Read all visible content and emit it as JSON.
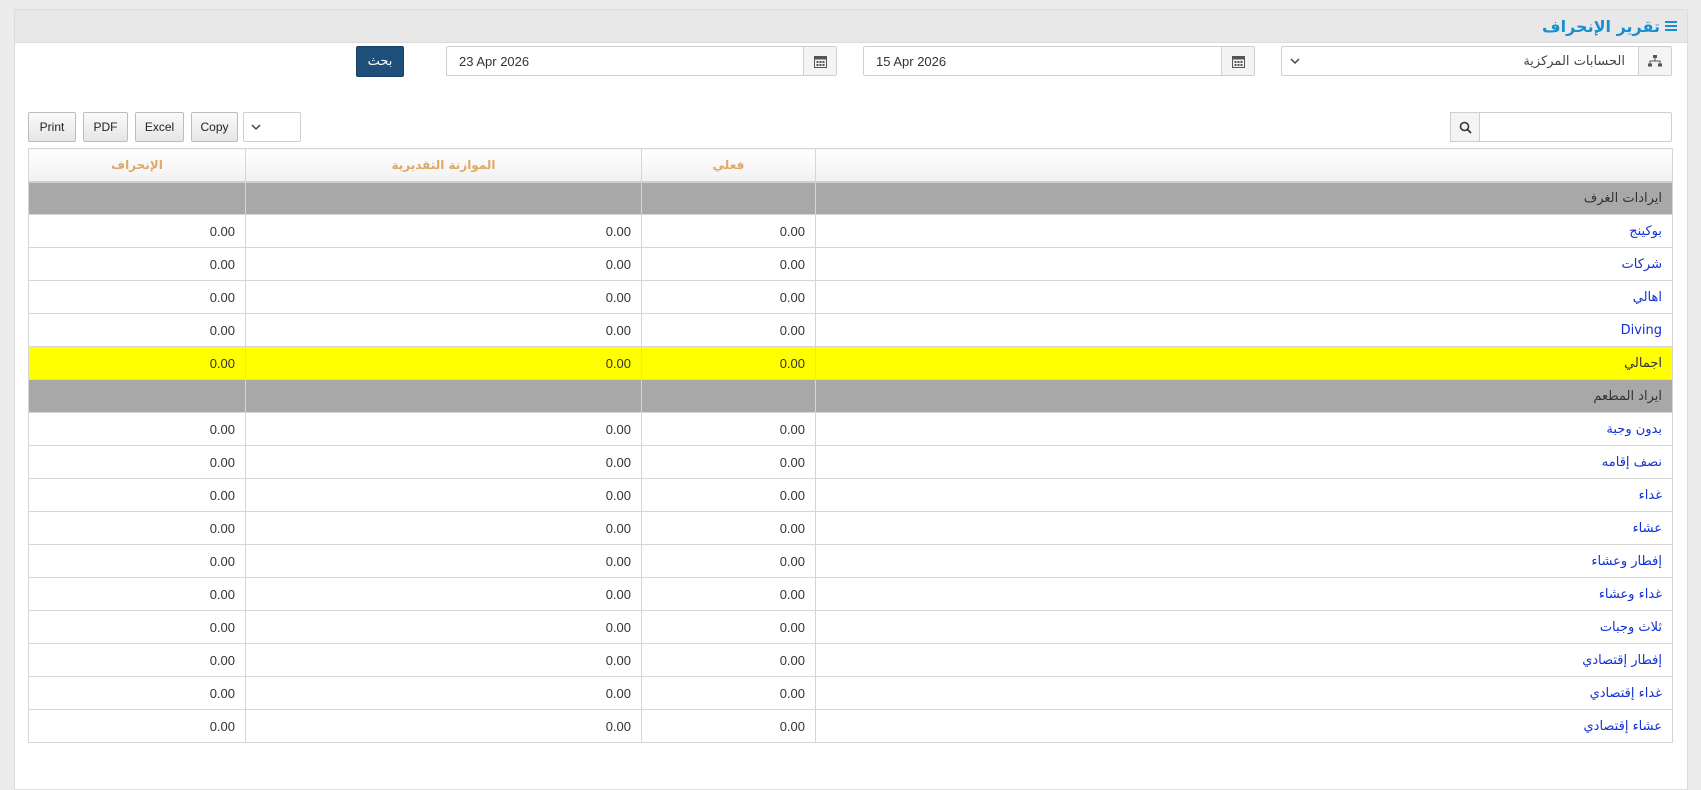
{
  "header": {
    "title": "تقرير الإنحراف",
    "icon": "bars-icon"
  },
  "filters": {
    "account_select": {
      "value": "الحسابات المركزية",
      "icon": "sitemap-icon"
    },
    "date_from": {
      "value": "15 Apr 2026",
      "icon": "calendar-icon"
    },
    "date_to": {
      "value": "23 Apr 2026",
      "icon": "calendar-icon"
    },
    "search_label": "بحث"
  },
  "toolbar": {
    "print": "Print",
    "pdf": "PDF",
    "excel": "Excel",
    "copy": "Copy",
    "page_length": ""
  },
  "table": {
    "columns": [
      "",
      "فعلي",
      "الموازنة التقديرية",
      "الإنحراف"
    ],
    "rows": [
      {
        "type": "group",
        "name": "ايرادات الغرف",
        "actual": "",
        "budget": "",
        "variance": ""
      },
      {
        "type": "item",
        "name": "بوكينج",
        "actual": "0.00",
        "budget": "0.00",
        "variance": "0.00"
      },
      {
        "type": "item",
        "name": "شركات",
        "actual": "0.00",
        "budget": "0.00",
        "variance": "0.00"
      },
      {
        "type": "item",
        "name": "اهالي",
        "actual": "0.00",
        "budget": "0.00",
        "variance": "0.00"
      },
      {
        "type": "item",
        "name": "Diving",
        "actual": "0.00",
        "budget": "0.00",
        "variance": "0.00"
      },
      {
        "type": "total",
        "name": "اجمالي",
        "actual": "0.00",
        "budget": "0.00",
        "variance": "0.00"
      },
      {
        "type": "group",
        "name": "ايراد المطعم",
        "actual": "",
        "budget": "",
        "variance": ""
      },
      {
        "type": "item",
        "name": "بدون وجبة",
        "actual": "0.00",
        "budget": "0.00",
        "variance": "0.00"
      },
      {
        "type": "item",
        "name": "نصف إقامه",
        "actual": "0.00",
        "budget": "0.00",
        "variance": "0.00"
      },
      {
        "type": "item",
        "name": "غداء",
        "actual": "0.00",
        "budget": "0.00",
        "variance": "0.00"
      },
      {
        "type": "item",
        "name": "عشاء",
        "actual": "0.00",
        "budget": "0.00",
        "variance": "0.00"
      },
      {
        "type": "item",
        "name": "إفطار وعشاء",
        "actual": "0.00",
        "budget": "0.00",
        "variance": "0.00"
      },
      {
        "type": "item",
        "name": "غداء وعشاء",
        "actual": "0.00",
        "budget": "0.00",
        "variance": "0.00"
      },
      {
        "type": "item",
        "name": "ثلاث وجبات",
        "actual": "0.00",
        "budget": "0.00",
        "variance": "0.00"
      },
      {
        "type": "item",
        "name": "إفطار إقتصادي",
        "actual": "0.00",
        "budget": "0.00",
        "variance": "0.00"
      },
      {
        "type": "item",
        "name": "غداء إقتصادي",
        "actual": "0.00",
        "budget": "0.00",
        "variance": "0.00"
      },
      {
        "type": "item",
        "name": "عشاء إقتصادي",
        "actual": "0.00",
        "budget": "0.00",
        "variance": "0.00"
      }
    ]
  },
  "colors": {
    "accent": "#1a8fd0",
    "search_button": "#1e4f7a",
    "group_row": "#a8a8a8",
    "total_row": "#ffff00",
    "link": "#1030d8",
    "header_text": "#e0a765"
  }
}
